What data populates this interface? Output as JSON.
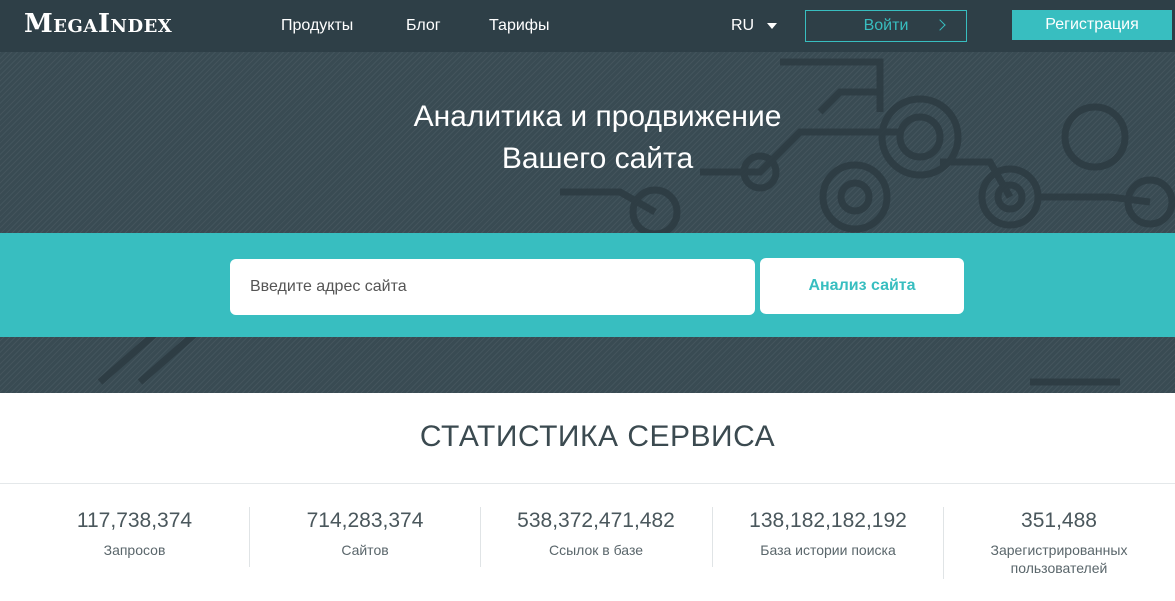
{
  "header": {
    "logo": "MegaIndex",
    "nav": [
      {
        "label": "Продукты"
      },
      {
        "label": "Блог"
      },
      {
        "label": "Тарифы"
      }
    ],
    "language": "RU",
    "login_label": "Войти",
    "register_label": "Регистрация"
  },
  "hero": {
    "title_line1": "Аналитика и продвижение",
    "title_line2": "Вашего сайта",
    "search_placeholder": "Введите адрес сайта",
    "analyze_label": "Анализ сайта"
  },
  "stats": {
    "title": "СТАТИСТИКА СЕРВИСА",
    "items": [
      {
        "value": "117,738,374",
        "label": "Запросов"
      },
      {
        "value": "714,283,374",
        "label": "Сайтов"
      },
      {
        "value": "538,372,471,482",
        "label": "Ссылок в базе"
      },
      {
        "value": "138,182,182,192",
        "label": "База истории поиска"
      },
      {
        "value": "351,488",
        "label": "Зарегистрированных пользователей"
      }
    ]
  },
  "colors": {
    "header_bg": "#2e3f47",
    "accent": "#38bec0",
    "hero_bg": "#394b53"
  }
}
